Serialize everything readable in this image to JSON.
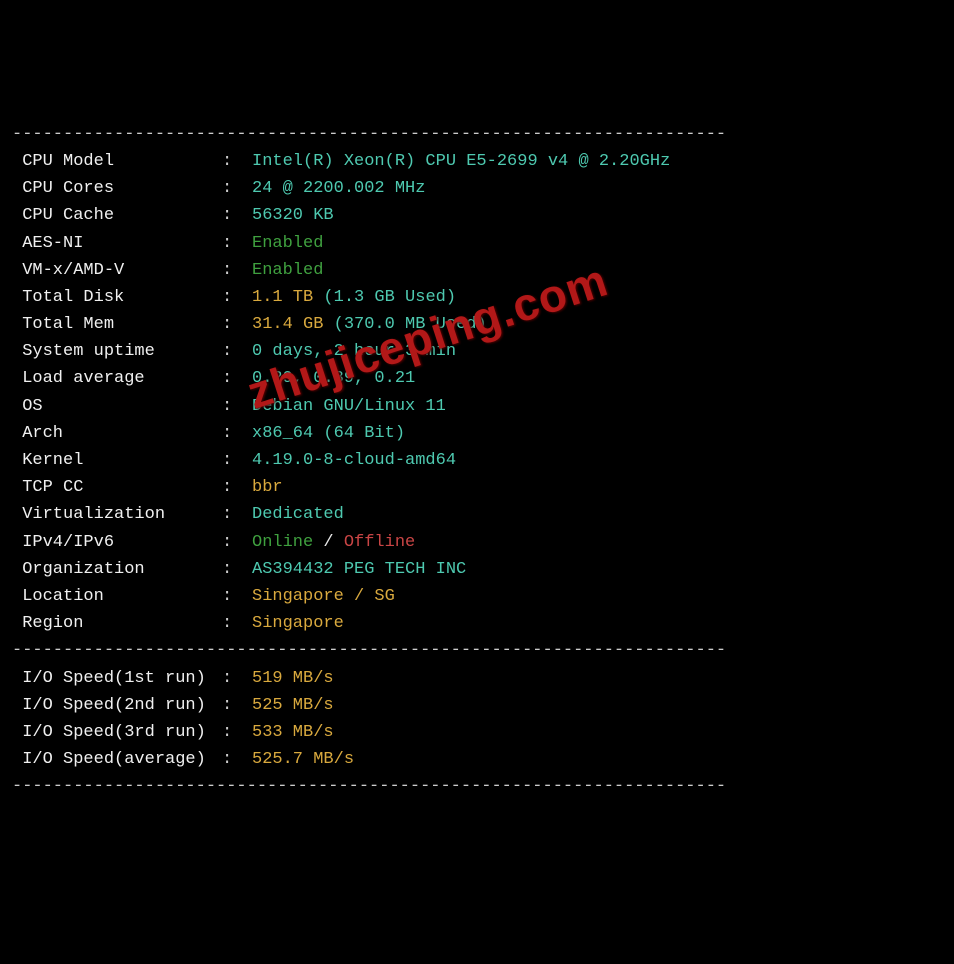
{
  "divider": "----------------------------------------------------------------------",
  "sep": ":",
  "watermark": "zhujiceping.com",
  "rows": [
    {
      "label": " CPU Model",
      "parts": [
        {
          "text": "Intel(R) Xeon(R) CPU E5-2699 v4 @ 2.20GHz",
          "cls": "cyan"
        }
      ]
    },
    {
      "label": " CPU Cores",
      "parts": [
        {
          "text": "24 @ 2200.002 MHz",
          "cls": "cyan"
        }
      ]
    },
    {
      "label": " CPU Cache",
      "parts": [
        {
          "text": "56320 KB",
          "cls": "cyan"
        }
      ]
    },
    {
      "label": " AES-NI",
      "parts": [
        {
          "text": "Enabled",
          "cls": "green"
        }
      ]
    },
    {
      "label": " VM-x/AMD-V",
      "parts": [
        {
          "text": "Enabled",
          "cls": "green"
        }
      ]
    },
    {
      "label": " Total Disk",
      "parts": [
        {
          "text": "1.1 TB ",
          "cls": "yellow"
        },
        {
          "text": "(1.3 GB Used)",
          "cls": "cyan"
        }
      ]
    },
    {
      "label": " Total Mem",
      "parts": [
        {
          "text": "31.4 GB ",
          "cls": "yellow"
        },
        {
          "text": "(370.0 MB Used)",
          "cls": "cyan"
        }
      ]
    },
    {
      "label": " System uptime",
      "parts": [
        {
          "text": "0 days, 2 hour 3 min",
          "cls": "cyan"
        }
      ]
    },
    {
      "label": " Load average",
      "parts": [
        {
          "text": "0.29, 0.39, 0.21",
          "cls": "cyan"
        }
      ]
    },
    {
      "label": " OS",
      "parts": [
        {
          "text": "Debian GNU/Linux 11",
          "cls": "cyan"
        }
      ]
    },
    {
      "label": " Arch",
      "parts": [
        {
          "text": "x86_64 (64 Bit)",
          "cls": "cyan"
        }
      ]
    },
    {
      "label": " Kernel",
      "parts": [
        {
          "text": "4.19.0-8-cloud-amd64",
          "cls": "cyan"
        }
      ]
    },
    {
      "label": " TCP CC",
      "parts": [
        {
          "text": "bbr",
          "cls": "yellow"
        }
      ]
    },
    {
      "label": " Virtualization",
      "parts": [
        {
          "text": "Dedicated",
          "cls": "cyan"
        }
      ]
    },
    {
      "label": " IPv4/IPv6",
      "parts": [
        {
          "text": "Online",
          "cls": "green"
        },
        {
          "text": " / ",
          "cls": "white"
        },
        {
          "text": "Offline",
          "cls": "red-off"
        }
      ]
    },
    {
      "label": " Organization",
      "parts": [
        {
          "text": "AS394432 PEG TECH INC",
          "cls": "cyan"
        }
      ]
    },
    {
      "label": " Location",
      "parts": [
        {
          "text": "Singapore / SG",
          "cls": "yellow"
        }
      ]
    },
    {
      "label": " Region",
      "parts": [
        {
          "text": "Singapore",
          "cls": "yellow"
        }
      ]
    }
  ],
  "io_rows": [
    {
      "label": " I/O Speed(1st run)",
      "parts": [
        {
          "text": "519 MB/s",
          "cls": "yellow"
        }
      ]
    },
    {
      "label": " I/O Speed(2nd run)",
      "parts": [
        {
          "text": "525 MB/s",
          "cls": "yellow"
        }
      ]
    },
    {
      "label": " I/O Speed(3rd run)",
      "parts": [
        {
          "text": "533 MB/s",
          "cls": "yellow"
        }
      ]
    },
    {
      "label": " I/O Speed(average)",
      "parts": [
        {
          "text": "525.7 MB/s",
          "cls": "yellow"
        }
      ]
    }
  ]
}
